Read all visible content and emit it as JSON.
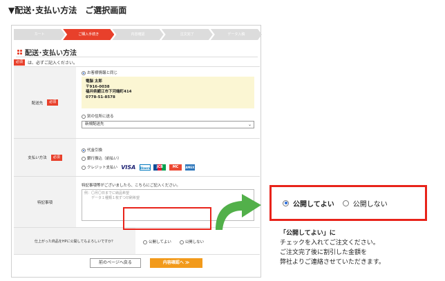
{
  "page_heading": "▼配送･支払い方法　ご選択画面",
  "steps": [
    {
      "label": "カート",
      "active": false
    },
    {
      "label": "ご購入手続き",
      "active": true
    },
    {
      "label": "内容確認",
      "active": false
    },
    {
      "label": "注文完了",
      "active": false
    },
    {
      "label": "データ入稿",
      "active": false
    }
  ],
  "section_title": "配送･支払い方法",
  "required_badge": "必須",
  "required_note": "は、必ずご記入ください。",
  "delivery": {
    "label": "配送先",
    "option_same": "お客様情報と同じ",
    "address_lines": [
      "電脳 太郎",
      "〒916-0038",
      "福井県鯖江市下河端町414",
      "0778-51-8578"
    ],
    "option_other": "別の住所に送る",
    "select_value": "新規配送先"
  },
  "payment": {
    "label": "支払い方法",
    "options": [
      "代金引換",
      "銀行振込（前払い）",
      "クレジット支払い"
    ],
    "cards": [
      "VISA",
      "Diners",
      "JCB",
      "MC",
      "AMEX"
    ]
  },
  "notes": {
    "label": "特記事項",
    "prompt": "特記事項等がございましたら、こちらにご記入ください。",
    "placeholder_lines": [
      "例：〇月〇日までに納品希望",
      "データ１種類１枚ずつ印刷希望"
    ]
  },
  "publish": {
    "question": "仕上がった商品をHPに公開してもよろしいですか？",
    "yes": "公開してよい",
    "no": "公開しない"
  },
  "buttons": {
    "back": "前のページへ戻る",
    "next": "内容確認へ ≫"
  },
  "callout": {
    "yes": "公開してよい",
    "no": "公開しない",
    "lines": [
      "「公開してよい」に",
      "チェックを入れてご注文ください。",
      "ご注文完了後に割引した金額を",
      "弊社よりご連絡させていただきます。"
    ]
  },
  "colors": {
    "accent": "#e8402b",
    "highlight_border": "#e8231a",
    "next_button": "#f29a1b",
    "arrow": "#52b04a",
    "address_bg": "#fbf6d3"
  }
}
